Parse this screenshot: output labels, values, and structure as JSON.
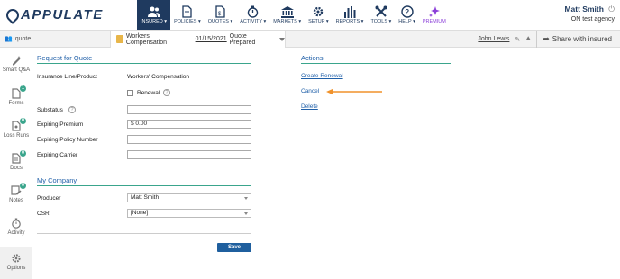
{
  "brand": {
    "name": "APPULATE"
  },
  "nav": {
    "items": [
      {
        "label": "INSURED",
        "icon": "people-icon",
        "active": true
      },
      {
        "label": "POLICIES",
        "icon": "document-icon"
      },
      {
        "label": "QUOTES",
        "icon": "calculator-icon"
      },
      {
        "label": "ACTIVITY",
        "icon": "stopwatch-icon"
      },
      {
        "label": "MARKETS",
        "icon": "bank-icon"
      },
      {
        "label": "SETUP",
        "icon": "gear-icon"
      },
      {
        "label": "REPORTS",
        "icon": "bar-chart-icon"
      },
      {
        "label": "TOOLS",
        "icon": "tools-icon"
      },
      {
        "label": "HELP",
        "icon": "question-icon"
      },
      {
        "label": "PREMIUM",
        "icon": "sparkle-icon"
      }
    ]
  },
  "user": {
    "name": "Matt Smith",
    "agency": "ON test agency"
  },
  "subbar": {
    "quote_label": "quote",
    "line": "Workers' Compensation",
    "date": "01/15/2021",
    "status": "Quote Prepared",
    "owner": "John Lewis",
    "share_label": "Share with insured"
  },
  "sidebar": {
    "items": [
      {
        "label": "Smart Q&A",
        "icon": "smart-qa-icon"
      },
      {
        "label": "Forms",
        "icon": "forms-icon",
        "badge": "1"
      },
      {
        "label": "Loss Runs",
        "icon": "loss-runs-icon",
        "badge": "0"
      },
      {
        "label": "Docs",
        "icon": "docs-icon",
        "badge": "0"
      },
      {
        "label": "Notes",
        "icon": "notes-icon",
        "badge": "0"
      },
      {
        "label": "Activity",
        "icon": "activity-icon"
      },
      {
        "label": "Options",
        "icon": "gear-icon"
      }
    ]
  },
  "request": {
    "title": "Request for Quote",
    "line_label": "Insurance Line/Product",
    "line_value": "Workers' Compensation",
    "renewal_label": "Renewal",
    "substatus_label": "Substatus",
    "substatus_value": "",
    "expiring_premium_label": "Expiring Premium",
    "expiring_premium_value": "$ 0.00",
    "expiring_policy_label": "Expiring Policy Number",
    "expiring_policy_value": "",
    "expiring_carrier_label": "Expiring Carrier",
    "expiring_carrier_value": ""
  },
  "company": {
    "title": "My Company",
    "producer_label": "Producer",
    "producer_value": "Matt Smith",
    "csr_label": "CSR",
    "csr_value": "[None]"
  },
  "save_label": "Save",
  "actions": {
    "title": "Actions",
    "create_renewal": "Create Renewal",
    "cancel": "Cancel",
    "delete": "Delete"
  },
  "colors": {
    "navy": "#1f3a5f",
    "accent_green": "#3aa58c",
    "link_blue": "#1f5fa8",
    "arrow_orange": "#f0922b",
    "premium_purple": "#8b3fd9"
  }
}
